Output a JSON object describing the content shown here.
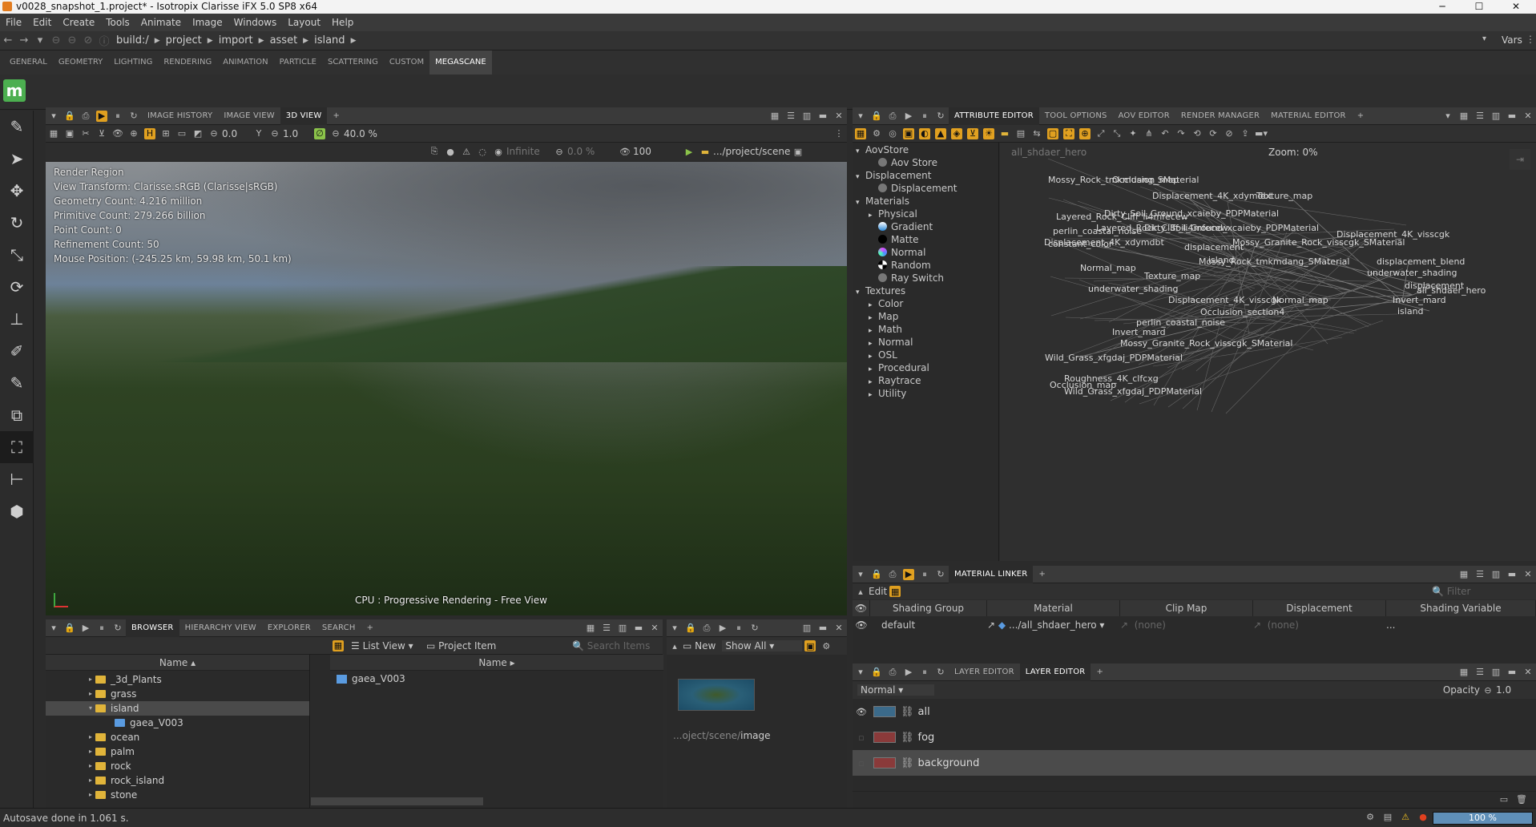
{
  "window": {
    "title": "v0028_snapshot_1.project* - Isotropix Clarisse iFX 5.0 SP8 x64",
    "minimize": "─",
    "maximize": "☐",
    "close": "✕"
  },
  "menu": [
    "File",
    "Edit",
    "Create",
    "Tools",
    "Animate",
    "Image",
    "Windows",
    "Layout",
    "Help"
  ],
  "path": {
    "crumbs": [
      "build:/",
      "project",
      "import",
      "asset",
      "island"
    ],
    "vars_label": "Vars"
  },
  "shelf": {
    "tabs": [
      "GENERAL",
      "GEOMETRY",
      "LIGHTING",
      "RENDERING",
      "ANIMATION",
      "PARTICLE",
      "SCATTERING",
      "CUSTOM",
      "MEGASCANE"
    ],
    "active": "MEGASCANE",
    "logo": "m"
  },
  "viewer": {
    "tabs": [
      "IMAGE HISTORY",
      "IMAGE VIEW",
      "3D VIEW"
    ],
    "active_tab": "3D VIEW",
    "toolbar": {
      "exposure": "0.0",
      "gamma": "1.0",
      "zoom": "40.0 %",
      "infinite": "Infinite",
      "percent": "0.0 %",
      "samples": "100",
      "scene_path": ".../project/scene"
    },
    "info": {
      "render_region": "Render Region",
      "view_transform": "View Transform: Clarisse.sRGB (Clarisse|sRGB)",
      "geometry_count": "Geometry Count: 4.216 million",
      "primitive_count": "Primitive Count: 279.266 billion",
      "point_count": "Point Count: 0",
      "refinement_count": "Refinement Count: 50",
      "mouse_position": "Mouse Position: (-245.25 km, 59.98 km, 50.1 km)"
    },
    "status": "CPU : Progressive Rendering - Free View"
  },
  "browser": {
    "tabs": [
      "BROWSER",
      "HIERARCHY VIEW",
      "EXPLORER",
      "SEARCH"
    ],
    "active_tab": "BROWSER",
    "list_view": "List View",
    "project_item": "Project Item",
    "search_placeholder": "Search Items",
    "name_col": "Name",
    "tree": [
      {
        "label": "_3d_Plants",
        "indent": 0,
        "expanded": false,
        "color": "#e0b43a",
        "selected": false,
        "type": "folder"
      },
      {
        "label": "grass",
        "indent": 0,
        "expanded": false,
        "color": "#e0b43a",
        "selected": false,
        "type": "folder"
      },
      {
        "label": "island",
        "indent": 0,
        "expanded": true,
        "color": "#e0b43a",
        "selected": true,
        "type": "folder"
      },
      {
        "label": "gaea_V003",
        "indent": 1,
        "expanded": false,
        "color": "#5a9be0",
        "selected": false,
        "type": "context"
      },
      {
        "label": "ocean",
        "indent": 0,
        "expanded": false,
        "color": "#e0b43a",
        "selected": false,
        "type": "folder"
      },
      {
        "label": "palm",
        "indent": 0,
        "expanded": false,
        "color": "#e0b43a",
        "selected": false,
        "type": "folder"
      },
      {
        "label": "rock",
        "indent": 0,
        "expanded": false,
        "color": "#e0b43a",
        "selected": false,
        "type": "folder"
      },
      {
        "label": "rock_island",
        "indent": 0,
        "expanded": false,
        "color": "#e0b43a",
        "selected": false,
        "type": "folder"
      },
      {
        "label": "stone",
        "indent": 0,
        "expanded": false,
        "color": "#e0b43a",
        "selected": false,
        "type": "folder"
      }
    ],
    "content_items": [
      "gaea_V003"
    ]
  },
  "image_panel": {
    "new_label": "New",
    "filter": "Show All",
    "path_prefix": "...oject/scene/",
    "path_name": "image"
  },
  "attribute_editor": {
    "tabs": [
      "ATTRIBUTE EDITOR",
      "TOOL OPTIONS",
      "AOV EDITOR",
      "RENDER MANAGER",
      "MATERIAL EDITOR"
    ],
    "active_tab": "ATTRIBUTE EDITOR",
    "tree": [
      {
        "label": "AovStore",
        "level": 0,
        "arrow": "▾"
      },
      {
        "label": "Aov Store",
        "level": 1,
        "arrow": ""
      },
      {
        "label": "Displacement",
        "level": 0,
        "arrow": "▾"
      },
      {
        "label": "Displacement",
        "level": 1,
        "arrow": ""
      },
      {
        "label": "Materials",
        "level": 0,
        "arrow": "▾"
      },
      {
        "label": "Physical",
        "level": 1,
        "arrow": "▸"
      },
      {
        "label": "Gradient",
        "level": 1,
        "arrow": ""
      },
      {
        "label": "Matte",
        "level": 1,
        "arrow": ""
      },
      {
        "label": "Normal",
        "level": 1,
        "arrow": ""
      },
      {
        "label": "Random",
        "level": 1,
        "arrow": ""
      },
      {
        "label": "Ray Switch",
        "level": 1,
        "arrow": ""
      },
      {
        "label": "Textures",
        "level": 0,
        "arrow": "▾"
      },
      {
        "label": "Color",
        "level": 1,
        "arrow": "▸"
      },
      {
        "label": "Map",
        "level": 1,
        "arrow": "▸"
      },
      {
        "label": "Math",
        "level": 1,
        "arrow": "▸"
      },
      {
        "label": "Normal",
        "level": 1,
        "arrow": "▸"
      },
      {
        "label": "OSL",
        "level": 1,
        "arrow": "▸"
      },
      {
        "label": "Procedural",
        "level": 1,
        "arrow": "▸"
      },
      {
        "label": "Raytrace",
        "level": 1,
        "arrow": "▸"
      },
      {
        "label": "Utility",
        "level": 1,
        "arrow": "▸"
      }
    ],
    "graph_title": "all_shdaer_hero",
    "zoom": "Zoom: 0%",
    "nodes": [
      "Displacement_4K_visscgk",
      "displacement_blend",
      "underwater_shading",
      "displacement",
      "all_shdaer_hero",
      "Invert_mard",
      "island",
      "Mossy_Rock_tmkmdang_SMaterial",
      "Mossy_Granite_Rock_visscgk_SMaterial",
      "Dirty_Soil_Ground_xcaieby_PDPMaterial",
      "Layered_Rock_Cliff_li4mfecew",
      "Occlusion_map",
      "Occlusion_section4",
      "perlin_coastal_noise",
      "Wild_Grass_xfgdaj_PDPMaterial",
      "Roughness_4K_clfcxg",
      "Displacement_4K_xdymdbt",
      "Texture_map",
      "constant_color",
      "Normal_map"
    ]
  },
  "material_linker": {
    "title": "MATERIAL LINKER",
    "edit_label": "Edit",
    "filter_placeholder": "Filter",
    "columns": [
      "Shading Group",
      "Material",
      "Clip Map",
      "Displacement",
      "Shading Variable"
    ],
    "row": {
      "group": "default",
      "material": ".../all_shdaer_hero",
      "clip_map": "(none)",
      "displacement": "(none)",
      "variable": "..."
    }
  },
  "layer_editor": {
    "tabs": [
      "LAYER EDITOR",
      "LAYER EDITOR"
    ],
    "active_index": 1,
    "blend_mode": "Normal",
    "opacity_label": "Opacity",
    "opacity_value": "1.0",
    "layers": [
      {
        "name": "all",
        "visible": true,
        "selected": false,
        "thumb": "#3b6a8a"
      },
      {
        "name": "fog",
        "visible": false,
        "selected": false,
        "thumb": "#8a3a3a"
      },
      {
        "name": "background",
        "visible": false,
        "selected": true,
        "thumb": "#8a3a3a"
      }
    ]
  },
  "status": {
    "message": "Autosave done in 1.061 s.",
    "progress": "100 %",
    "progress_fraction": 1.0
  }
}
